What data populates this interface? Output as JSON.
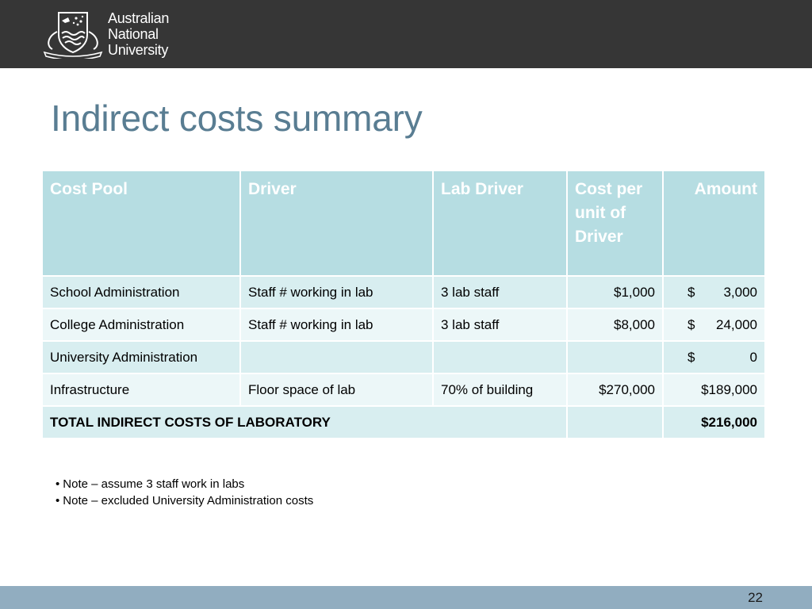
{
  "header": {
    "logo_lines": [
      "Australian",
      "National",
      "University"
    ]
  },
  "slide": {
    "title": "Indirect costs summary",
    "page_number": "22"
  },
  "table": {
    "headers": [
      "Cost Pool",
      "Driver",
      "Lab Driver",
      "Cost per unit of Driver",
      "Amount"
    ],
    "rows": [
      {
        "cost_pool": "School Administration",
        "driver": "Staff # working in lab",
        "lab_driver": "3 lab staff",
        "cost_per_unit": "$1,000",
        "amount_symbol": "$",
        "amount_value": "3,000"
      },
      {
        "cost_pool": "College Administration",
        "driver": "Staff # working in lab",
        "lab_driver": "3 lab staff",
        "cost_per_unit": "$8,000",
        "amount_symbol": "$",
        "amount_value": "24,000"
      },
      {
        "cost_pool": "University Administration",
        "driver": "",
        "lab_driver": "",
        "cost_per_unit": "",
        "amount_symbol": "$",
        "amount_value": "0"
      },
      {
        "cost_pool": "Infrastructure",
        "driver": "Floor space of lab",
        "lab_driver": "70% of building",
        "cost_per_unit": "$270,000",
        "amount_symbol": "",
        "amount_value": "$189,000"
      }
    ],
    "total": {
      "label": "TOTAL INDIRECT COSTS OF LABORATORY",
      "amount": "$216,000"
    }
  },
  "notes": [
    "Note – assume 3 staff work in labs",
    "Note – excluded University Administration costs"
  ],
  "colors": {
    "header_bg": "#363636",
    "title": "#597d92",
    "table_header_bg": "#b6dde2",
    "row_dark": "#d8eef0",
    "row_light": "#ecf7f8",
    "footer_bg": "#91adc0"
  }
}
